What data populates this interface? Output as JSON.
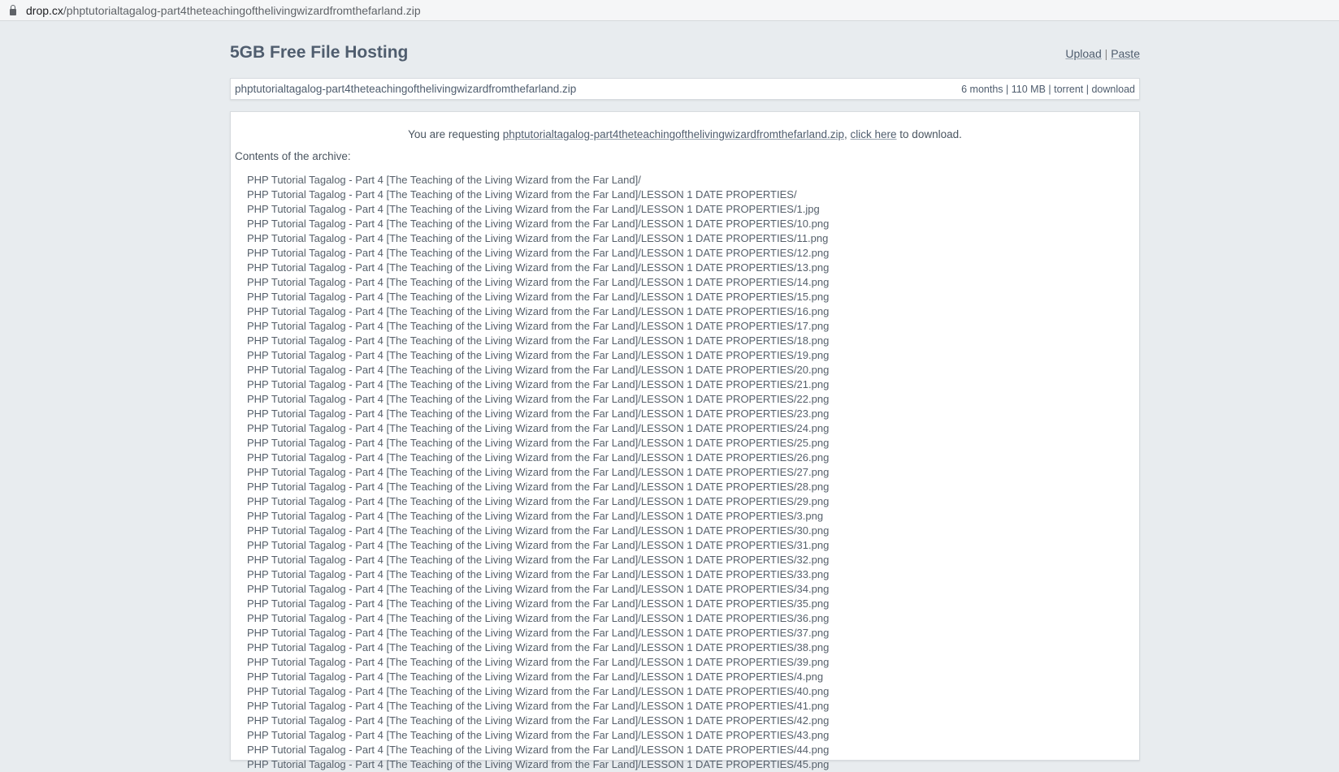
{
  "browser": {
    "url_host": "drop.cx",
    "url_path": "/phptutorialtagalog-part4theteachingofthelivingwizardfromthefarland.zip"
  },
  "header": {
    "title": "5GB Free File Hosting",
    "upload_label": "Upload",
    "separator": "|",
    "paste_label": "Paste"
  },
  "file": {
    "name": "phptutorialtagalog-part4theteachingofthelivingwizardfromthefarland.zip",
    "age": "6 months",
    "size": "110 MB",
    "torrent_label": "torrent",
    "download_label": "download",
    "sep": "|"
  },
  "request": {
    "prefix": "You are requesting ",
    "filename": "phptutorialtagalog-part4theteachingofthelivingwizardfromthefarland.zip",
    "comma": ", ",
    "click_here": "click here",
    "suffix": " to download."
  },
  "archive": {
    "label": "Contents of the archive:",
    "entries": [
      "PHP Tutorial Tagalog - Part 4 [The Teaching of the Living Wizard from the Far Land]/",
      "PHP Tutorial Tagalog - Part 4 [The Teaching of the Living Wizard from the Far Land]/LESSON 1 DATE PROPERTIES/",
      "PHP Tutorial Tagalog - Part 4 [The Teaching of the Living Wizard from the Far Land]/LESSON 1 DATE PROPERTIES/1.jpg",
      "PHP Tutorial Tagalog - Part 4 [The Teaching of the Living Wizard from the Far Land]/LESSON 1 DATE PROPERTIES/10.png",
      "PHP Tutorial Tagalog - Part 4 [The Teaching of the Living Wizard from the Far Land]/LESSON 1 DATE PROPERTIES/11.png",
      "PHP Tutorial Tagalog - Part 4 [The Teaching of the Living Wizard from the Far Land]/LESSON 1 DATE PROPERTIES/12.png",
      "PHP Tutorial Tagalog - Part 4 [The Teaching of the Living Wizard from the Far Land]/LESSON 1 DATE PROPERTIES/13.png",
      "PHP Tutorial Tagalog - Part 4 [The Teaching of the Living Wizard from the Far Land]/LESSON 1 DATE PROPERTIES/14.png",
      "PHP Tutorial Tagalog - Part 4 [The Teaching of the Living Wizard from the Far Land]/LESSON 1 DATE PROPERTIES/15.png",
      "PHP Tutorial Tagalog - Part 4 [The Teaching of the Living Wizard from the Far Land]/LESSON 1 DATE PROPERTIES/16.png",
      "PHP Tutorial Tagalog - Part 4 [The Teaching of the Living Wizard from the Far Land]/LESSON 1 DATE PROPERTIES/17.png",
      "PHP Tutorial Tagalog - Part 4 [The Teaching of the Living Wizard from the Far Land]/LESSON 1 DATE PROPERTIES/18.png",
      "PHP Tutorial Tagalog - Part 4 [The Teaching of the Living Wizard from the Far Land]/LESSON 1 DATE PROPERTIES/19.png",
      "PHP Tutorial Tagalog - Part 4 [The Teaching of the Living Wizard from the Far Land]/LESSON 1 DATE PROPERTIES/20.png",
      "PHP Tutorial Tagalog - Part 4 [The Teaching of the Living Wizard from the Far Land]/LESSON 1 DATE PROPERTIES/21.png",
      "PHP Tutorial Tagalog - Part 4 [The Teaching of the Living Wizard from the Far Land]/LESSON 1 DATE PROPERTIES/22.png",
      "PHP Tutorial Tagalog - Part 4 [The Teaching of the Living Wizard from the Far Land]/LESSON 1 DATE PROPERTIES/23.png",
      "PHP Tutorial Tagalog - Part 4 [The Teaching of the Living Wizard from the Far Land]/LESSON 1 DATE PROPERTIES/24.png",
      "PHP Tutorial Tagalog - Part 4 [The Teaching of the Living Wizard from the Far Land]/LESSON 1 DATE PROPERTIES/25.png",
      "PHP Tutorial Tagalog - Part 4 [The Teaching of the Living Wizard from the Far Land]/LESSON 1 DATE PROPERTIES/26.png",
      "PHP Tutorial Tagalog - Part 4 [The Teaching of the Living Wizard from the Far Land]/LESSON 1 DATE PROPERTIES/27.png",
      "PHP Tutorial Tagalog - Part 4 [The Teaching of the Living Wizard from the Far Land]/LESSON 1 DATE PROPERTIES/28.png",
      "PHP Tutorial Tagalog - Part 4 [The Teaching of the Living Wizard from the Far Land]/LESSON 1 DATE PROPERTIES/29.png",
      "PHP Tutorial Tagalog - Part 4 [The Teaching of the Living Wizard from the Far Land]/LESSON 1 DATE PROPERTIES/3.png",
      "PHP Tutorial Tagalog - Part 4 [The Teaching of the Living Wizard from the Far Land]/LESSON 1 DATE PROPERTIES/30.png",
      "PHP Tutorial Tagalog - Part 4 [The Teaching of the Living Wizard from the Far Land]/LESSON 1 DATE PROPERTIES/31.png",
      "PHP Tutorial Tagalog - Part 4 [The Teaching of the Living Wizard from the Far Land]/LESSON 1 DATE PROPERTIES/32.png",
      "PHP Tutorial Tagalog - Part 4 [The Teaching of the Living Wizard from the Far Land]/LESSON 1 DATE PROPERTIES/33.png",
      "PHP Tutorial Tagalog - Part 4 [The Teaching of the Living Wizard from the Far Land]/LESSON 1 DATE PROPERTIES/34.png",
      "PHP Tutorial Tagalog - Part 4 [The Teaching of the Living Wizard from the Far Land]/LESSON 1 DATE PROPERTIES/35.png",
      "PHP Tutorial Tagalog - Part 4 [The Teaching of the Living Wizard from the Far Land]/LESSON 1 DATE PROPERTIES/36.png",
      "PHP Tutorial Tagalog - Part 4 [The Teaching of the Living Wizard from the Far Land]/LESSON 1 DATE PROPERTIES/37.png",
      "PHP Tutorial Tagalog - Part 4 [The Teaching of the Living Wizard from the Far Land]/LESSON 1 DATE PROPERTIES/38.png",
      "PHP Tutorial Tagalog - Part 4 [The Teaching of the Living Wizard from the Far Land]/LESSON 1 DATE PROPERTIES/39.png",
      "PHP Tutorial Tagalog - Part 4 [The Teaching of the Living Wizard from the Far Land]/LESSON 1 DATE PROPERTIES/4.png",
      "PHP Tutorial Tagalog - Part 4 [The Teaching of the Living Wizard from the Far Land]/LESSON 1 DATE PROPERTIES/40.png",
      "PHP Tutorial Tagalog - Part 4 [The Teaching of the Living Wizard from the Far Land]/LESSON 1 DATE PROPERTIES/41.png",
      "PHP Tutorial Tagalog - Part 4 [The Teaching of the Living Wizard from the Far Land]/LESSON 1 DATE PROPERTIES/42.png",
      "PHP Tutorial Tagalog - Part 4 [The Teaching of the Living Wizard from the Far Land]/LESSON 1 DATE PROPERTIES/43.png",
      "PHP Tutorial Tagalog - Part 4 [The Teaching of the Living Wizard from the Far Land]/LESSON 1 DATE PROPERTIES/44.png",
      "PHP Tutorial Tagalog - Part 4 [The Teaching of the Living Wizard from the Far Land]/LESSON 1 DATE PROPERTIES/45.png"
    ]
  }
}
